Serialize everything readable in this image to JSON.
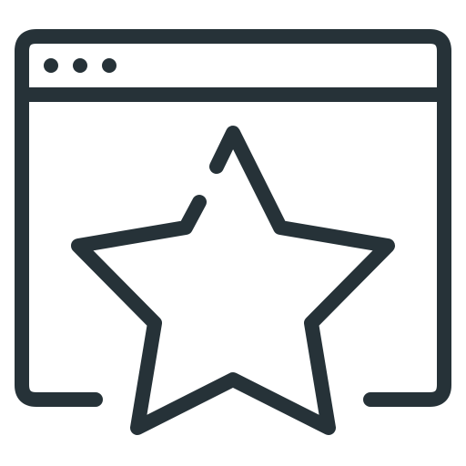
{
  "icon": {
    "name": "browser-window-star-icon",
    "stroke_color": "#263238",
    "background_color": "#ffffff"
  },
  "window_controls": {
    "dot_count": 3
  }
}
